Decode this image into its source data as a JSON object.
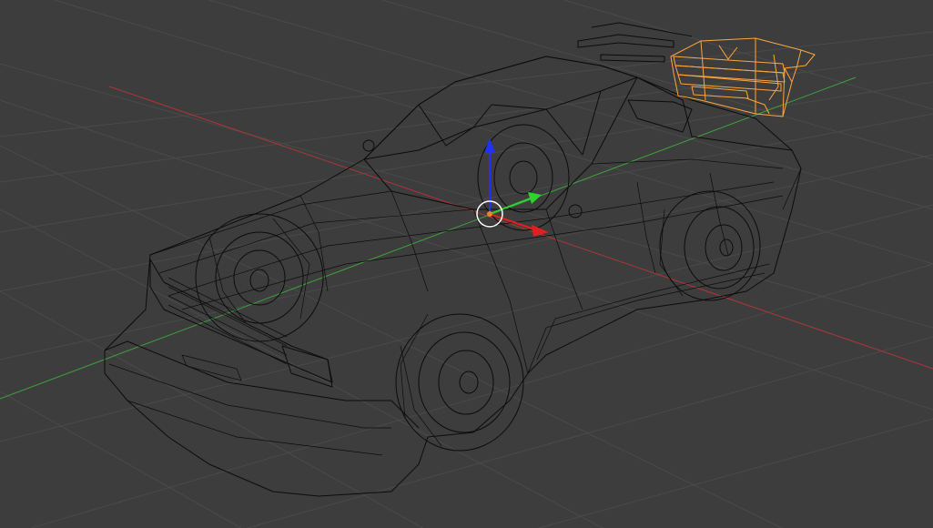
{
  "viewport": {
    "background_color": "#3d3d3d",
    "grid_color": "#4a4a4a",
    "wire_color": "#0c0c0c",
    "selection_color": "#ffa53d",
    "x_axis_color": "#b33535",
    "y_axis_color": "#3f9f3f",
    "z_axis_color": "#3040d0"
  },
  "object": {
    "name": "rally-car-wireframe",
    "selected_part": "rear-spoiler"
  },
  "manipulator": {
    "x_color": "#e02020",
    "y_color": "#30d030",
    "z_color": "#2030ff",
    "pivot_color": "#e08a30"
  }
}
